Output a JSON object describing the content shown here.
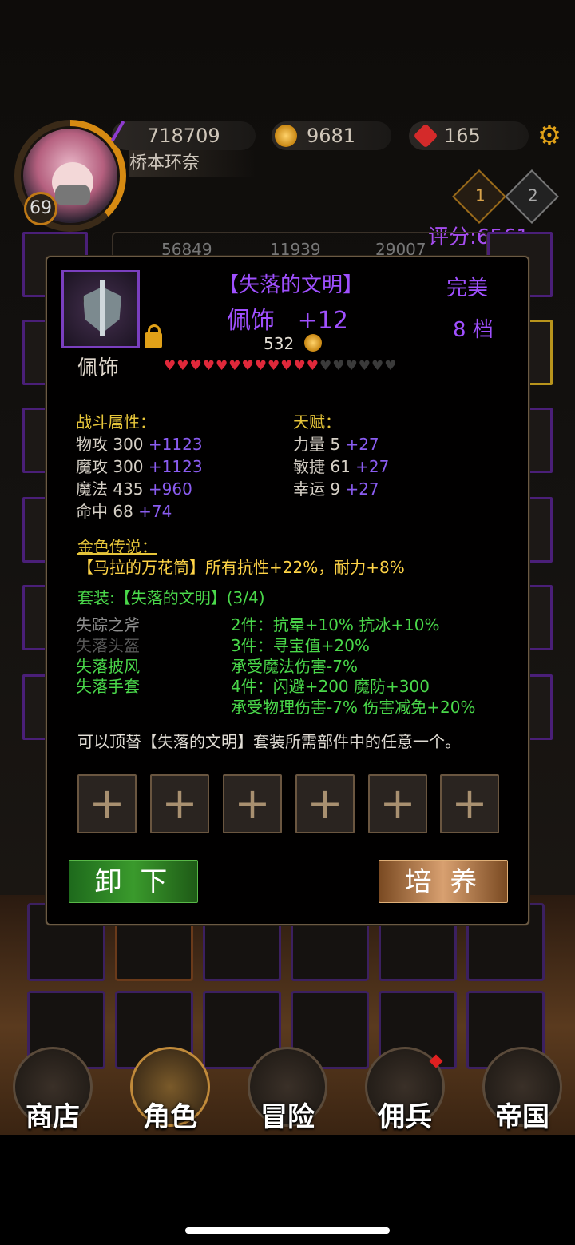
{
  "header": {
    "player_level": "69",
    "player_name": "桥本环奈",
    "resources": [
      {
        "name": "purple-crystal",
        "value": "718709"
      },
      {
        "name": "gold-coin",
        "value": "9681"
      },
      {
        "name": "red-gem",
        "value": "165"
      }
    ],
    "rank_badges": [
      "1",
      "2"
    ],
    "score": "评分:6561"
  },
  "background_stats": [
    "56849",
    "11939",
    "29007"
  ],
  "item": {
    "set_name": "【失落的文明】",
    "name": "佩饰",
    "enhance": "+12",
    "price": "532",
    "quality": "完美",
    "grade": "8 档",
    "type_label": "佩饰",
    "hearts_filled": 12,
    "hearts_total": 18
  },
  "combat": {
    "title": "战斗属性：",
    "stats": [
      {
        "label": "物攻 300",
        "bonus": "+1123"
      },
      {
        "label": "魔攻 300",
        "bonus": "+1123"
      },
      {
        "label": "魔法 435",
        "bonus": "+960"
      },
      {
        "label": "命中 68",
        "bonus": "+74"
      }
    ]
  },
  "talent": {
    "title": "天赋：",
    "stats": [
      {
        "label": "力量 5",
        "bonus": "+27"
      },
      {
        "label": "敏捷 61",
        "bonus": "+27"
      },
      {
        "label": "幸运 9",
        "bonus": "+27"
      }
    ]
  },
  "legend": {
    "title": "金色传说：",
    "text": "【马拉的万花筒】所有抗性+22%，耐力+8%"
  },
  "set": {
    "title": "套装:【失落的文明】(3/4)",
    "parts": [
      {
        "name": "失踪之斧",
        "owned": false
      },
      {
        "name": "失落头盔",
        "owned": false
      },
      {
        "name": "失落披风",
        "owned": true
      },
      {
        "name": "失落手套",
        "owned": true
      }
    ],
    "bonuses": [
      "2件：抗晕+10% 抗冰+10%",
      "3件：寻宝值+20%",
      "承受魔法伤害-7%",
      "4件：闪避+200 魔防+300",
      "承受物理伤害-7% 伤害减免+20%"
    ]
  },
  "note": "可以顶替【失落的文明】套装所需部件中的任意一个。",
  "sockets": [
    "+",
    "+",
    "+",
    "+",
    "+",
    "+"
  ],
  "buttons": {
    "unequip": "卸 下",
    "train": "培 养"
  },
  "nav": [
    {
      "label": "商店"
    },
    {
      "label": "角色"
    },
    {
      "label": "冒险"
    },
    {
      "label": "佣兵"
    },
    {
      "label": "帝国"
    }
  ],
  "colors": {
    "epic_purple": "#a050ff",
    "set_green": "#4ad84a",
    "gold": "#e6c53a"
  }
}
